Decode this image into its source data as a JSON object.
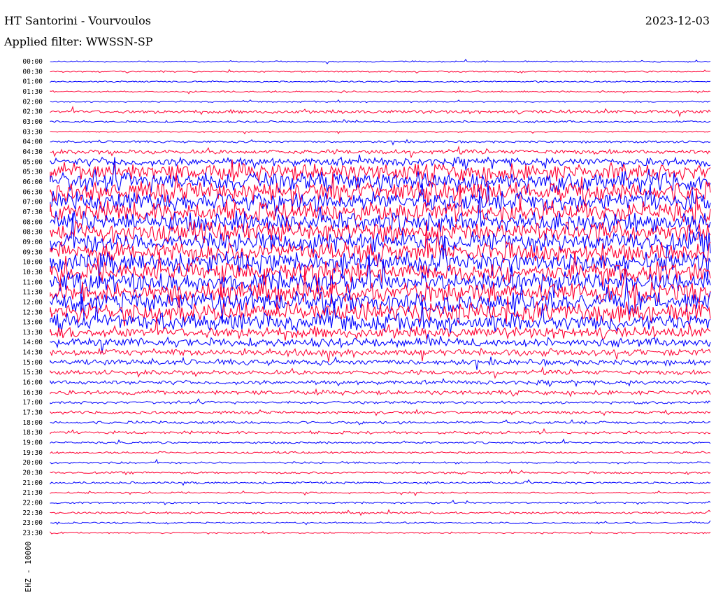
{
  "header": {
    "title": "HT Santorini - Vourvoulos",
    "date": "2023-12-03",
    "filter": "Applied filter: WWSSN-SP"
  },
  "chart_data": {
    "type": "line",
    "title": "HT Santorini - Vourvoulos",
    "subtitle": "Applied filter: WWSSN-SP",
    "ylabel": "EHZ - 10000",
    "xlabel": "",
    "y_tick_labels": [
      "00:00",
      "00:30",
      "01:00",
      "01:30",
      "02:00",
      "02:30",
      "03:00",
      "03:30",
      "04:00",
      "04:30",
      "05:00",
      "05:30",
      "06:00",
      "06:30",
      "07:00",
      "07:30",
      "08:00",
      "08:30",
      "09:00",
      "09:30",
      "10:00",
      "10:30",
      "11:00",
      "11:30",
      "12:00",
      "12:30",
      "13:00",
      "13:30",
      "14:00",
      "14:30",
      "15:00",
      "15:30",
      "16:00",
      "16:30",
      "17:00",
      "17:30",
      "18:00",
      "18:30",
      "19:00",
      "19:30",
      "20:00",
      "20:30",
      "21:00",
      "21:30",
      "22:00",
      "22:30",
      "23:00",
      "23:30"
    ],
    "trace_colors": [
      "#0000ff",
      "#ff0033"
    ],
    "trace_amplitude": [
      1,
      1,
      1,
      1.2,
      1,
      2.5,
      1.5,
      1,
      1.5,
      3,
      6,
      12,
      14,
      14,
      14,
      14,
      14,
      14,
      14,
      14,
      14,
      14,
      14,
      14,
      14,
      14,
      12,
      8,
      6,
      5,
      4,
      3,
      3,
      3,
      2,
      2,
      2,
      2,
      1.5,
      1.5,
      1.5,
      1.5,
      1.5,
      1.2,
      1.2,
      1.5,
      1.2,
      1.2
    ],
    "grid": false,
    "legend": "none"
  }
}
